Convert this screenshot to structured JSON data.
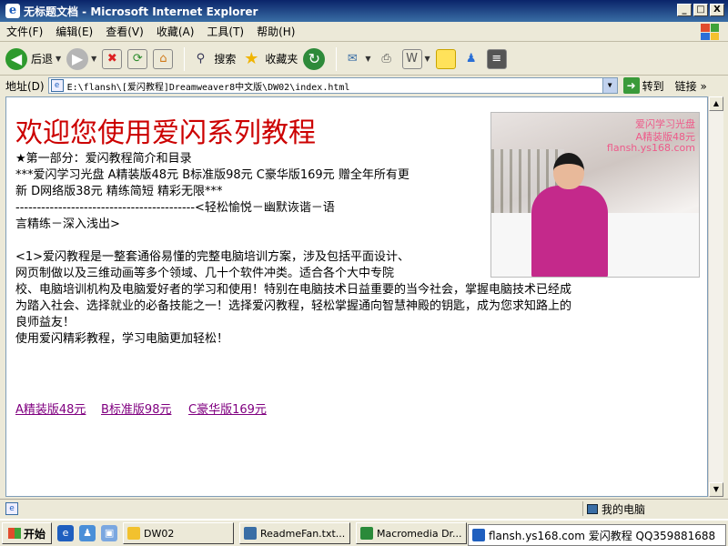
{
  "window": {
    "title": "无标题文档 - Microsoft Internet Explorer",
    "minimize": "_",
    "maximize": "□",
    "close": "X"
  },
  "menu": [
    "文件(F)",
    "编辑(E)",
    "查看(V)",
    "收藏(A)",
    "工具(T)",
    "帮助(H)"
  ],
  "toolbar": {
    "back_label": "后退",
    "search_label": "搜索",
    "favorites_label": "收藏夹"
  },
  "address": {
    "label": "地址(D)",
    "value": "E:\\flansh\\[爱闪教程]Dreamweaver8中文版\\DW02\\index.html",
    "go_label": "转到",
    "links_label": "链接"
  },
  "page": {
    "title": "欢迎您使用爱闪系列教程",
    "section_heading": "★第一部分：爱闪教程简介和目录",
    "promo_line1": "***爱闪学习光盘 A精装版48元 B标准版98元 C豪华版169元 赠全年所有更",
    "promo_line2": "新 D网络版38元  精练简短  精彩无限***",
    "divider_line": "------------------------------------------<轻松愉悦－幽默诙谐－语",
    "divider_line2": "言精练－深入浅出>",
    "para_line1": "<1>爱闪教程是一整套通俗易懂的完整电脑培训方案，涉及包括平面设计、",
    "para_line2": "网页制做以及三维动画等多个领域、几十个软件冲类。适合各个大中专院",
    "para_line3": "校、电脑培训机构及电脑爱好者的学习和使用！特别在电脑技术日益重要的当今社会，掌握电脑技术已经成",
    "para_line4": "为踏入社会、选择就业的必备技能之一！选择爱闪教程，轻松掌握通向智慧神殿的钥匙，成为您求知路上的",
    "para_line5": "良师益友！",
    "para_line6": "使用爱闪精彩教程，学习电脑更加轻松！",
    "photo_watermark": [
      "爱闪学习光盘",
      "A精装版48元",
      "flansh.ys168.com"
    ],
    "links": [
      "A精装版48元",
      "B标准版98元",
      "C豪华版169元"
    ]
  },
  "status": {
    "zone_label": "我的电脑"
  },
  "taskbar": {
    "start_label": "开始",
    "tasks": [
      "DW02",
      "ReadmeFan.txt...",
      "Macromedia Dr..."
    ],
    "tray_text": "flansh.ys168.com 爱闪教程 QQ359881688"
  },
  "colors": {
    "title_red": "#cc0000",
    "visited_link": "#800080",
    "coat_pink": "#c4298b"
  }
}
